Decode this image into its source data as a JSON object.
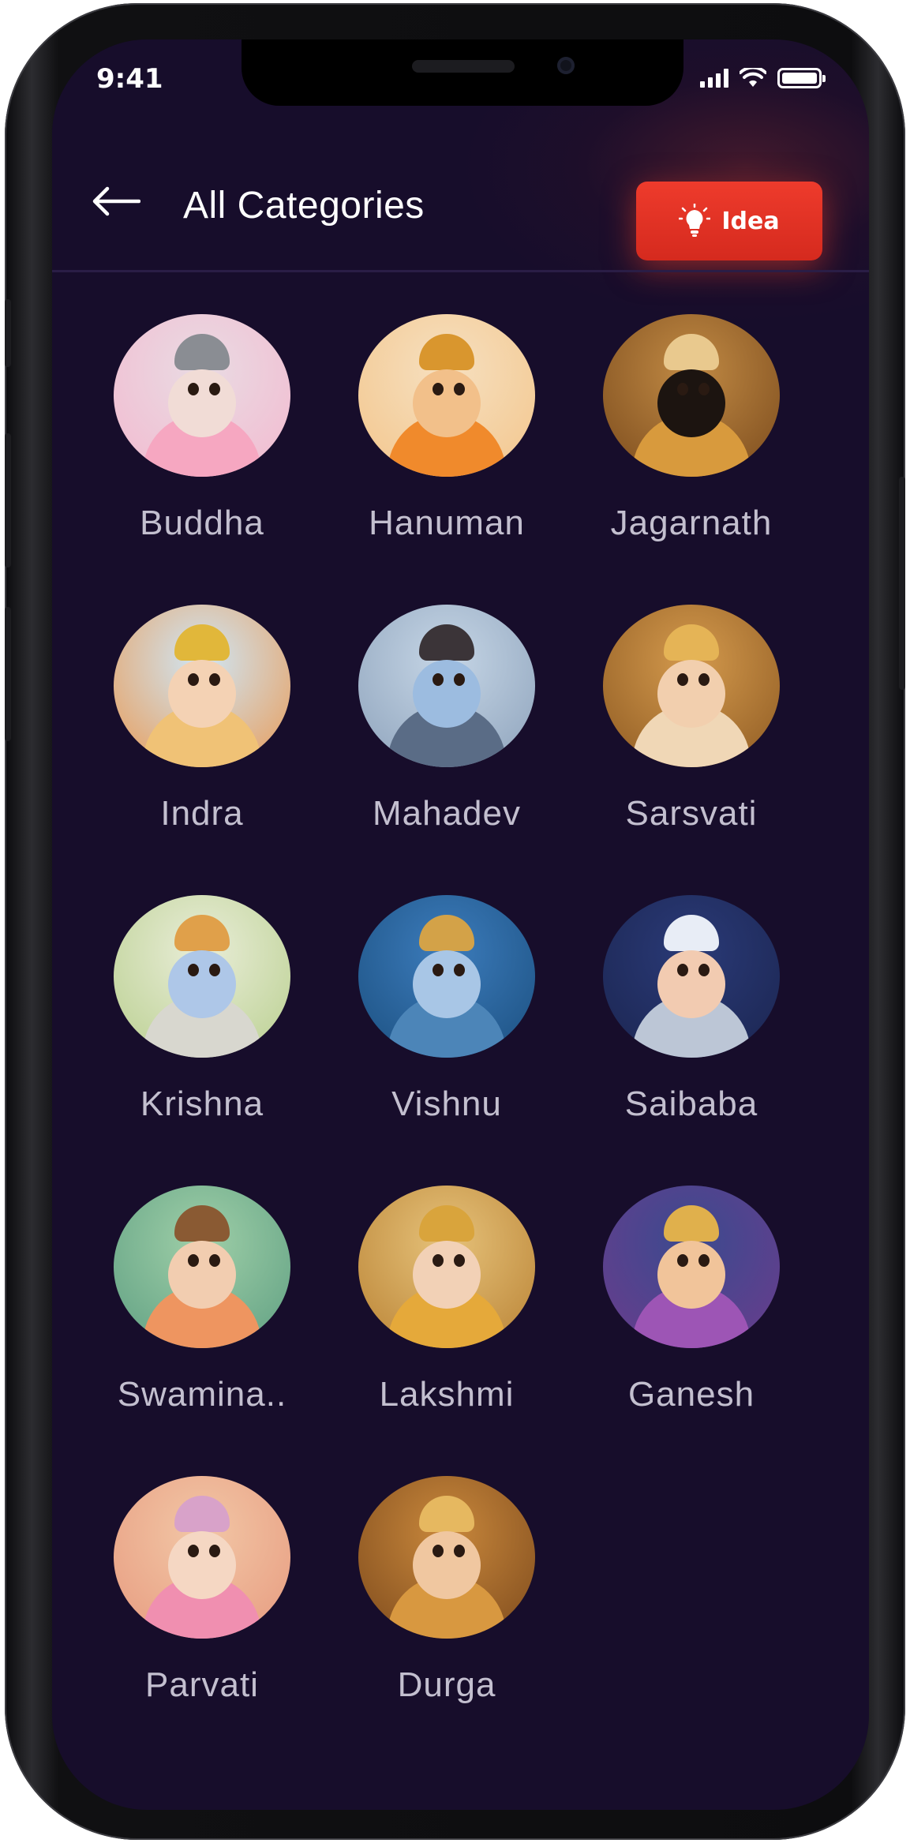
{
  "status_bar": {
    "time": "9:41"
  },
  "header": {
    "title": "All Categories",
    "idea_label": "Idea"
  },
  "categories": [
    {
      "label": "Buddha",
      "bg": "#e9dbe3",
      "bg2": "#f3b9cf",
      "skin": "#f1dcd6",
      "crown": "#8a8d93",
      "body": "#f6a7c1"
    },
    {
      "label": "Hanuman",
      "bg": "#f6e0c0",
      "bg2": "#f3c58b",
      "skin": "#f2c08a",
      "crown": "#d9962e",
      "body": "#f08a2c"
    },
    {
      "label": "Jagarnath",
      "bg": "#c18a44",
      "bg2": "#7a4a1c",
      "skin": "#1c1410",
      "crown": "#e9c98e",
      "body": "#d89a3d"
    },
    {
      "label": "Indra",
      "bg": "#cfe6f5",
      "bg2": "#e99a55",
      "skin": "#f4d2b4",
      "crown": "#e1b73a",
      "body": "#f0c276"
    },
    {
      "label": "Mahadev",
      "bg": "#c6d6e6",
      "bg2": "#8da2bb",
      "skin": "#9cbce0",
      "crown": "#3b3438",
      "body": "#5a6c86"
    },
    {
      "label": "Sarsvati",
      "bg": "#d49a4d",
      "bg2": "#8e5a22",
      "skin": "#f2cfae",
      "crown": "#e5b456",
      "body": "#f0d7b6"
    },
    {
      "label": "Krishna",
      "bg": "#e9edd8",
      "bg2": "#b9cf8f",
      "skin": "#aec7e8",
      "crown": "#e0a04a",
      "body": "#d8d7cf"
    },
    {
      "label": "Vishnu",
      "bg": "#3c7cbc",
      "bg2": "#1b4f7f",
      "skin": "#a8c6e6",
      "crown": "#d3a248",
      "body": "#4c85b8"
    },
    {
      "label": "Saibaba",
      "bg": "#2a3a77",
      "bg2": "#1b2550",
      "skin": "#f2cbb1",
      "crown": "#e8edf6",
      "body": "#bcc6d6"
    },
    {
      "label": "Swamina..",
      "bg": "#9fcfa8",
      "bg2": "#5f9f82",
      "skin": "#f2cdb0",
      "crown": "#8a5a33",
      "body": "#ee9560"
    },
    {
      "label": "Lakshmi",
      "bg": "#e6c27a",
      "bg2": "#b98234",
      "skin": "#f2d1b6",
      "crown": "#d9a43c",
      "body": "#e5a93a"
    },
    {
      "label": "Ganesh",
      "bg": "#3b4a8f",
      "bg2": "#6b3c8c",
      "skin": "#f1c49a",
      "crown": "#e0b04c",
      "body": "#9d55b5"
    },
    {
      "label": "Parvati",
      "bg": "#f2c7a6",
      "bg2": "#e79a7f",
      "skin": "#f5d7c3",
      "crown": "#d8a2c9",
      "body": "#f08fb0"
    },
    {
      "label": "Durga",
      "bg": "#c9883c",
      "bg2": "#7d4a1c",
      "skin": "#f0c7a0",
      "crown": "#e6b860",
      "body": "#d89840"
    }
  ],
  "colors": {
    "background": "#170d2b",
    "accent": "#e63427",
    "label": "#c3bfcf"
  }
}
